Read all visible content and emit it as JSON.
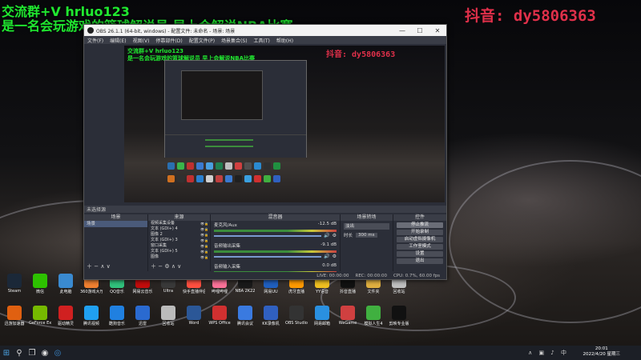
{
  "overlay": {
    "line1": "交流群+V hrluo123",
    "line2": "是一名会玩游戏的篮球解说员 早上会解说NBA比赛",
    "douyin": "抖音: dy5806363"
  },
  "obs": {
    "title": "OBS 26.1.1 (64-bit, windows) - 配置文件: 未命名 - 场景: 场景",
    "menu": [
      "文件(F)",
      "编辑(E)",
      "视图(V)",
      "停靠部件(D)",
      "配置文件(P)",
      "场景集合(S)",
      "工具(T)",
      "帮助(H)"
    ],
    "window_buttons": {
      "minimize": "—",
      "maximize": "☐",
      "close": "✕"
    },
    "preview_text": {
      "line1": "交流群+V hrluo123",
      "line2": "是一名会玩游戏的篮球解说员 早上会解说NBA比赛",
      "douyin": "抖音: dy5806363"
    },
    "scene_bar": "未选择源",
    "scenes": {
      "header": "场景",
      "items": [
        "场景"
      ]
    },
    "sources": {
      "header": "来源",
      "items": [
        "视频采集设备",
        "文本 (GDI+) 4",
        "图像 2",
        "文本 (GDI+) 3",
        "窗口采集",
        "文本 (GDI+) 5",
        "图像"
      ]
    },
    "mixer": {
      "header": "混音器",
      "channels": [
        {
          "name": "麦克风/Aux",
          "db": "-12.5 dB"
        },
        {
          "name": "音频输出采集",
          "db": "-9.1 dB"
        },
        {
          "name": "音频输入采集",
          "db": "0.0 dB"
        }
      ]
    },
    "transitions": {
      "header": "场景转场",
      "type": "淡出",
      "duration_label": "时长",
      "duration": "300 ms"
    },
    "controls": {
      "header": "控件",
      "buttons": [
        "停止推流",
        "开始录制",
        "启动虚拟摄像机",
        "工作室模式",
        "设置",
        "退出"
      ]
    },
    "status": {
      "live": "LIVE: 00:00:00",
      "rec": "REC: 00:00:00",
      "cpu": "CPU: 0.7%, 60.00 fps"
    }
  },
  "desktop_icons_row1": [
    "Steam",
    "微信",
    "此电脑",
    "360游戏大厅",
    "QQ音乐",
    "网易云音乐",
    "Ultra",
    "快手直播伴侣",
    "哔哩哔哩",
    "NBA 2K22",
    "网易UU",
    "虎牙直播",
    "YY语音",
    "抖音直播",
    "文件夹",
    "回收站"
  ],
  "desktop_icons_row2": [
    "迅游加速器",
    "GeForce Experience",
    "驱动精灵",
    "腾讯视频",
    "酷狗音乐",
    "迅雷",
    "回收站",
    "Word",
    "WPS Office",
    "腾讯会议",
    "KK录像机",
    "OBS Studio",
    "网易邮箱",
    "WeGame",
    "模拟人生4",
    "剪映专业版"
  ],
  "taskbar": {
    "clock_time": "20:01",
    "clock_date": "2022/4/20 星期三"
  },
  "colors": {
    "overlay_green": "#20e830",
    "overlay_red": "#e0304a",
    "obs_bg": "#2b2e38"
  }
}
